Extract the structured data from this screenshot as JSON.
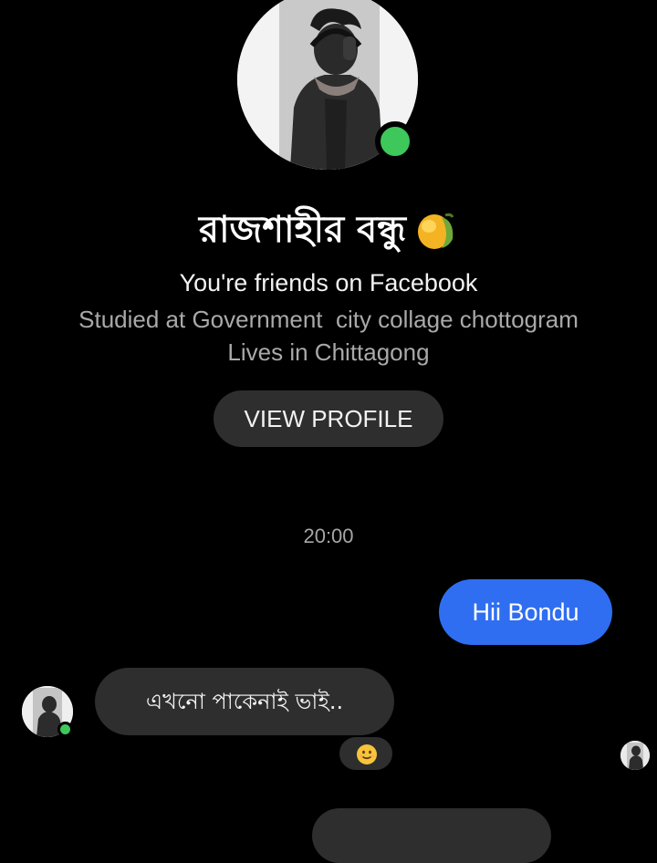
{
  "contact": {
    "name": "রাজশাহীর বন্ধু",
    "name_emoji": "mango-icon",
    "relationship": "You're friends on Facebook",
    "studied": "Studied at Government  city collage chottogram",
    "lives": "Lives in Chittagong",
    "online": true
  },
  "view_profile_label": "VIEW PROFILE",
  "timestamp": "20:00",
  "messages": [
    {
      "direction": "sent",
      "text": "Hii Bondu"
    },
    {
      "direction": "received",
      "text": "এখনো পাকেনাই ভাই.."
    }
  ],
  "reaction": {
    "emoji": "slightly-smiling-face-icon"
  },
  "colors": {
    "background": "#000000",
    "sent_bubble": "#2f6ef0",
    "received_bubble": "#2e2e2e",
    "online": "#3ec75a",
    "secondary_text": "#a9a9a9"
  }
}
